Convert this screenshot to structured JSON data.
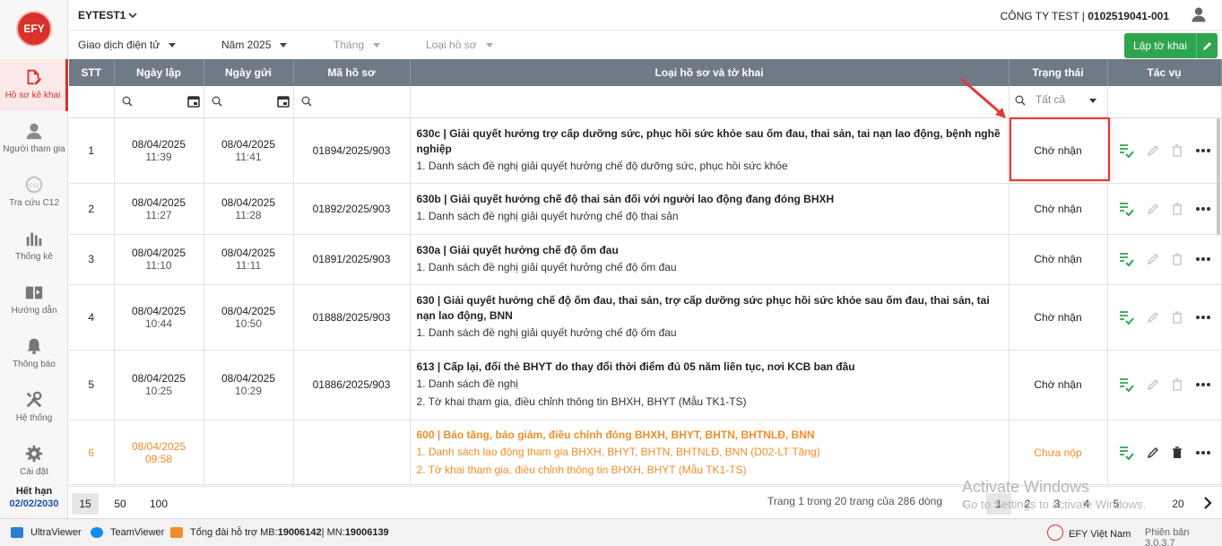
{
  "brand": {
    "logo_text": "EFY",
    "accent": "#d9312b",
    "primary_green": "#2ea54e"
  },
  "sidebar": {
    "items": [
      {
        "label": "Hồ sơ kê khai",
        "icon": "file-edit-icon",
        "active": true
      },
      {
        "label": "Người tham gia",
        "icon": "user-icon"
      },
      {
        "label": "Tra cứu C12",
        "icon": "lookup-icon"
      },
      {
        "label": "Thống kê",
        "icon": "bar-chart-icon"
      },
      {
        "label": "Hướng dẫn",
        "icon": "book-icon"
      },
      {
        "label": "Thông báo",
        "icon": "bell-icon"
      },
      {
        "label": "Hệ thống",
        "icon": "tools-icon"
      },
      {
        "label": "Cài đặt",
        "icon": "gear-icon"
      }
    ],
    "expire_label": "Hết hạn",
    "expire_date": "02/02/2030"
  },
  "header": {
    "org": "EYTEST1",
    "company": "CÔNG TY TEST | ",
    "tax_code": "0102519041-001"
  },
  "filters": {
    "transaction": "Giao dịch điện tử",
    "year": "Năm 2025",
    "month": "Tháng",
    "doc_type": "Loại hồ sơ",
    "create_button": "Lập tờ khai"
  },
  "table": {
    "columns": [
      "STT",
      "Ngày lập",
      "Ngày gửi",
      "Mã hồ sơ",
      "Loại hồ sơ và tờ khai",
      "Trạng thái",
      "Tác vụ"
    ],
    "status_filter": "Tất cả",
    "rows": [
      {
        "stt": "1",
        "created_date": "08/04/2025",
        "created_time": "11:39",
        "sent_date": "08/04/2025",
        "sent_time": "11:41",
        "code": "01894/2025/903",
        "title": "630c | Giải quyết hưởng trợ cấp dưỡng sức, phục hồi sức khỏe sau ốm đau, thai sản, tai nạn lao động, bệnh nghề nghiệp",
        "subs": [
          "1. Danh sách đề nghị giải quyết hưởng chế độ dưỡng sức, phục hồi sức khỏe"
        ],
        "status": "Chờ nhận"
      },
      {
        "stt": "2",
        "created_date": "08/04/2025",
        "created_time": "11:27",
        "sent_date": "08/04/2025",
        "sent_time": "11:28",
        "code": "01892/2025/903",
        "title": "630b | Giải quyết hưởng chế độ thai sản đối với người lao động đang đóng BHXH",
        "subs": [
          "1. Danh sách đề nghị giải quyết hưởng chế độ thai sản"
        ],
        "status": "Chờ nhận"
      },
      {
        "stt": "3",
        "created_date": "08/04/2025",
        "created_time": "11:10",
        "sent_date": "08/04/2025",
        "sent_time": "11:11",
        "code": "01891/2025/903",
        "title": "630a | Giải quyết hưởng chế độ ốm đau",
        "subs": [
          "1. Danh sách đề nghị giải quyết hưởng chế độ ốm đau"
        ],
        "status": "Chờ nhận"
      },
      {
        "stt": "4",
        "created_date": "08/04/2025",
        "created_time": "10:44",
        "sent_date": "08/04/2025",
        "sent_time": "10:50",
        "code": "01888/2025/903",
        "title": "630 | Giải quyết hưởng chế độ ốm đau, thai sản, trợ cấp dưỡng sức phục hồi sức khỏe sau ốm đau, thai sản, tai nạn lao động, BNN",
        "subs": [
          "1. Danh sách đề nghị giải quyết hưởng chế độ ốm đau"
        ],
        "status": "Chờ nhận"
      },
      {
        "stt": "5",
        "created_date": "08/04/2025",
        "created_time": "10:25",
        "sent_date": "08/04/2025",
        "sent_time": "10:29",
        "code": "01886/2025/903",
        "title": "613 | Cấp lại, đổi thẻ BHYT do thay đổi thời điểm đủ 05 năm liên tục, nơi KCB ban đầu",
        "subs": [
          "1. Danh sách đề nghị",
          "2. Tờ khai tham gia, điều chỉnh thông tin BHXH, BHYT (Mẫu TK1-TS)"
        ],
        "status": "Chờ nhận"
      },
      {
        "stt": "6",
        "created_date": "08/04/2025",
        "created_time": "09:58",
        "sent_date": "",
        "sent_time": "",
        "code": "",
        "title": "600 | Báo tăng, báo giảm, điều chỉnh đóng BHXH, BHYT, BHTN, BHTNLĐ, BNN",
        "subs": [
          "1. Danh sách lao động tham gia BHXH, BHYT, BHTN, BHTNLĐ, BNN (D02-LT Tăng)",
          "2. Tờ khai tham gia, điều chỉnh thông tin BHXH, BHYT (Mẫu TK1-TS)"
        ],
        "status": "Chưa nộp"
      }
    ]
  },
  "pager": {
    "sizes": [
      "15",
      "50",
      "100"
    ],
    "selected_size": "15",
    "info": "Trang 1 trong 20 trang của 286 dòng",
    "pages": [
      "1",
      "2",
      "3",
      "4",
      "5",
      "20"
    ],
    "current_page": "1"
  },
  "watermark": {
    "line1": "Activate Windows",
    "line2": "Go to Settings to activate Windows."
  },
  "bottombar": {
    "ultraviewer": "UltraViewer",
    "teamviewer": "TeamViewer",
    "hotline_prefix": "Tổng đài hỗ trợ MB: ",
    "hotline_mb": "19006142",
    "hotline_sep": " | MN: ",
    "hotline_mn": "19006139",
    "company": "EFY Việt Nam",
    "version": "Phiên bản 3.0.3.7"
  }
}
